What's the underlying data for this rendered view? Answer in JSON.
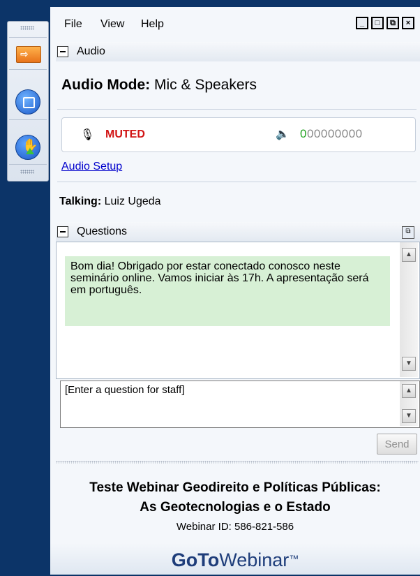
{
  "menu": {
    "file": "File",
    "view": "View",
    "help": "Help"
  },
  "window_controls": {
    "minimize": "_",
    "maximize": "□",
    "restore": "⧉",
    "close": "×"
  },
  "audio": {
    "header": "Audio",
    "mode_label": "Audio Mode:",
    "mode_value": "Mic & Speakers",
    "mic_icon": "🎙",
    "status": "MUTED",
    "speaker_icon": "🔈",
    "level_active": "0",
    "level_inactive": "00000000",
    "setup_link": "Audio Setup",
    "talking_label": "Talking:",
    "talking_name": "Luiz Ugeda"
  },
  "questions": {
    "header": "Questions",
    "message": "Bom dia! Obrigado por estar conectado conosco neste seminário online. Vamos iniciar às 17h. A apresentação será em português.",
    "input_value": "[Enter a question for staff]",
    "send_label": "Send"
  },
  "footer": {
    "title_line1": "Teste Webinar Geodireito e Políticas Públicas:",
    "title_line2": "As Geotecnologias e o Estado",
    "webinar_id": "Webinar ID: 586-821-586",
    "logo_bold": "GoTo",
    "logo_rest": "Webinar",
    "logo_tm": "™"
  },
  "colors": {
    "background": "#0c3468",
    "muted": "#d11414",
    "link": "#0000cc",
    "message_bg": "#d7f0d5",
    "level_active": "#22a322"
  },
  "icons": {
    "toolbar": [
      "grip",
      "arrow-icon",
      "screen-icon",
      "raise-hand-icon",
      "grip"
    ]
  }
}
